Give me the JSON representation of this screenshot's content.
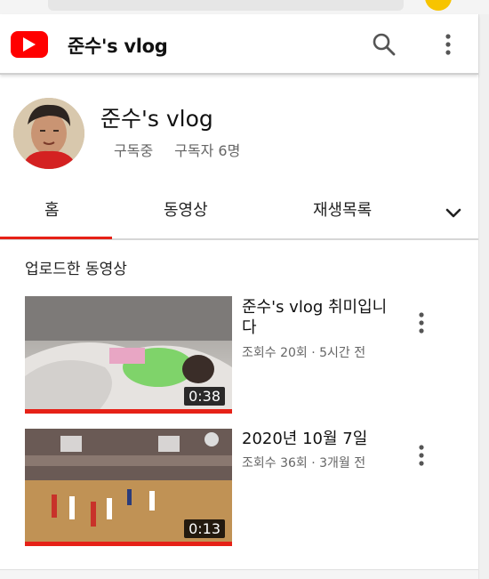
{
  "header": {
    "title": "준수's vlog",
    "logo_icon": "youtube-logo-icon",
    "search_icon": "search-icon",
    "more_icon": "more-vert-icon",
    "brand_color": "#ff0000"
  },
  "channel": {
    "name": "준수's vlog",
    "subscribed_label": "구독중",
    "subscriber_count": "구독자 6명"
  },
  "tabs": [
    {
      "label": "홈",
      "selected": true
    },
    {
      "label": "동영상",
      "selected": false
    },
    {
      "label": "재생목록",
      "selected": false
    }
  ],
  "tabs_more_icon": "chevron-down-icon",
  "section": {
    "title": "업로드한 동영상"
  },
  "videos": [
    {
      "title": "준수's vlog 취미입니다",
      "meta": "조회수 20회 · 5시간 전",
      "duration": "0:38",
      "watched_fraction": 1.0
    },
    {
      "title": "2020년 10월 7일",
      "meta": "조회수 36회 · 3개월 전",
      "duration": "0:13",
      "watched_fraction": 1.0
    }
  ],
  "colors": {
    "accent": "#e62117",
    "meta_text": "#666666"
  }
}
